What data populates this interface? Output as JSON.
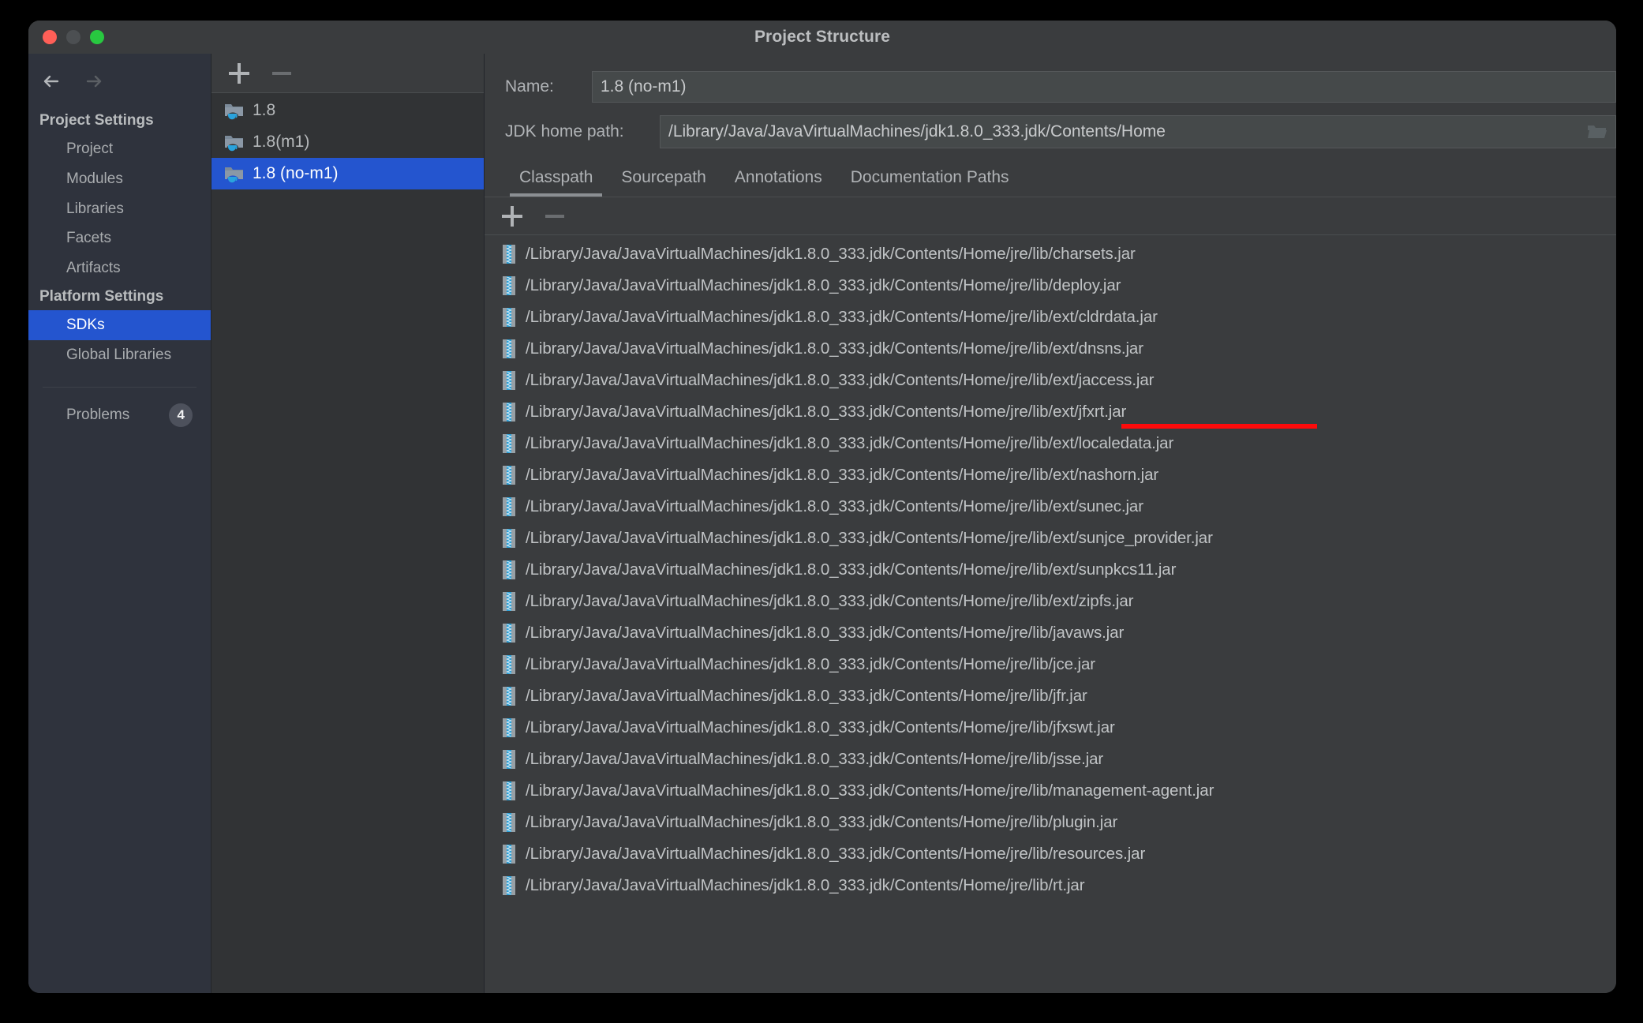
{
  "window": {
    "title": "Project Structure",
    "traffic_lights": [
      "close",
      "minimize",
      "zoom"
    ]
  },
  "sidebar": {
    "back_icon": "arrow-left-icon",
    "forward_icon": "arrow-right-icon",
    "groups": [
      {
        "title": "Project Settings",
        "items": [
          {
            "label": "Project",
            "selected": false
          },
          {
            "label": "Modules",
            "selected": false
          },
          {
            "label": "Libraries",
            "selected": false
          },
          {
            "label": "Facets",
            "selected": false
          },
          {
            "label": "Artifacts",
            "selected": false
          }
        ]
      },
      {
        "title": "Platform Settings",
        "items": [
          {
            "label": "SDKs",
            "selected": true
          },
          {
            "label": "Global Libraries",
            "selected": false
          }
        ]
      }
    ],
    "problems": {
      "label": "Problems",
      "count": "4"
    }
  },
  "sdk_panel": {
    "toolbar": {
      "add_label": "+",
      "remove_label": "−"
    },
    "items": [
      {
        "name": "1.8",
        "selected": false,
        "icon": "jdk-folder-icon"
      },
      {
        "name": "1.8(m1)",
        "selected": false,
        "icon": "jdk-folder-icon"
      },
      {
        "name": "1.8 (no-m1)",
        "selected": true,
        "icon": "jdk-folder-icon"
      }
    ]
  },
  "detail": {
    "name_label": "Name:",
    "name_value": "1.8 (no-m1)",
    "path_label": "JDK home path:",
    "path_value": "/Library/Java/JavaVirtualMachines/jdk1.8.0_333.jdk/Contents/Home",
    "browse_icon": "folder-open-icon",
    "tabs": [
      {
        "label": "Classpath",
        "active": true
      },
      {
        "label": "Sourcepath",
        "active": false
      },
      {
        "label": "Annotations",
        "active": false
      },
      {
        "label": "Documentation Paths",
        "active": false
      }
    ],
    "classpath_toolbar": {
      "add_label": "+",
      "remove_label": "−"
    },
    "classpath_entries": [
      {
        "path": "/Library/Java/JavaVirtualMachines/jdk1.8.0_333.jdk/Contents/Home/jre/lib/charsets.jar",
        "highlighted": false
      },
      {
        "path": "/Library/Java/JavaVirtualMachines/jdk1.8.0_333.jdk/Contents/Home/jre/lib/deploy.jar",
        "highlighted": false
      },
      {
        "path": "/Library/Java/JavaVirtualMachines/jdk1.8.0_333.jdk/Contents/Home/jre/lib/ext/cldrdata.jar",
        "highlighted": false
      },
      {
        "path": "/Library/Java/JavaVirtualMachines/jdk1.8.0_333.jdk/Contents/Home/jre/lib/ext/dnsns.jar",
        "highlighted": false
      },
      {
        "path": "/Library/Java/JavaVirtualMachines/jdk1.8.0_333.jdk/Contents/Home/jre/lib/ext/jaccess.jar",
        "highlighted": false
      },
      {
        "path": "/Library/Java/JavaVirtualMachines/jdk1.8.0_333.jdk/Contents/Home/jre/lib/ext/jfxrt.jar",
        "highlighted": true
      },
      {
        "path": "/Library/Java/JavaVirtualMachines/jdk1.8.0_333.jdk/Contents/Home/jre/lib/ext/localedata.jar",
        "highlighted": false
      },
      {
        "path": "/Library/Java/JavaVirtualMachines/jdk1.8.0_333.jdk/Contents/Home/jre/lib/ext/nashorn.jar",
        "highlighted": false
      },
      {
        "path": "/Library/Java/JavaVirtualMachines/jdk1.8.0_333.jdk/Contents/Home/jre/lib/ext/sunec.jar",
        "highlighted": false
      },
      {
        "path": "/Library/Java/JavaVirtualMachines/jdk1.8.0_333.jdk/Contents/Home/jre/lib/ext/sunjce_provider.jar",
        "highlighted": false
      },
      {
        "path": "/Library/Java/JavaVirtualMachines/jdk1.8.0_333.jdk/Contents/Home/jre/lib/ext/sunpkcs11.jar",
        "highlighted": false
      },
      {
        "path": "/Library/Java/JavaVirtualMachines/jdk1.8.0_333.jdk/Contents/Home/jre/lib/ext/zipfs.jar",
        "highlighted": false
      },
      {
        "path": "/Library/Java/JavaVirtualMachines/jdk1.8.0_333.jdk/Contents/Home/jre/lib/javaws.jar",
        "highlighted": false
      },
      {
        "path": "/Library/Java/JavaVirtualMachines/jdk1.8.0_333.jdk/Contents/Home/jre/lib/jce.jar",
        "highlighted": false
      },
      {
        "path": "/Library/Java/JavaVirtualMachines/jdk1.8.0_333.jdk/Contents/Home/jre/lib/jfr.jar",
        "highlighted": false
      },
      {
        "path": "/Library/Java/JavaVirtualMachines/jdk1.8.0_333.jdk/Contents/Home/jre/lib/jfxswt.jar",
        "highlighted": false
      },
      {
        "path": "/Library/Java/JavaVirtualMachines/jdk1.8.0_333.jdk/Contents/Home/jre/lib/jsse.jar",
        "highlighted": false
      },
      {
        "path": "/Library/Java/JavaVirtualMachines/jdk1.8.0_333.jdk/Contents/Home/jre/lib/management-agent.jar",
        "highlighted": false
      },
      {
        "path": "/Library/Java/JavaVirtualMachines/jdk1.8.0_333.jdk/Contents/Home/jre/lib/plugin.jar",
        "highlighted": false
      },
      {
        "path": "/Library/Java/JavaVirtualMachines/jdk1.8.0_333.jdk/Contents/Home/jre/lib/resources.jar",
        "highlighted": false
      },
      {
        "path": "/Library/Java/JavaVirtualMachines/jdk1.8.0_333.jdk/Contents/Home/jre/lib/rt.jar",
        "highlighted": false
      }
    ]
  },
  "colors": {
    "accent_selection": "#2455cf",
    "window_bg": "#3a3c3e",
    "sidebar_bg": "#2f333d",
    "list_bg": "#313335",
    "annotation_red": "#fd0b0b",
    "traffic_red": "#ff5f57",
    "traffic_yellow": "#4c4f52",
    "traffic_green": "#28c840"
  }
}
